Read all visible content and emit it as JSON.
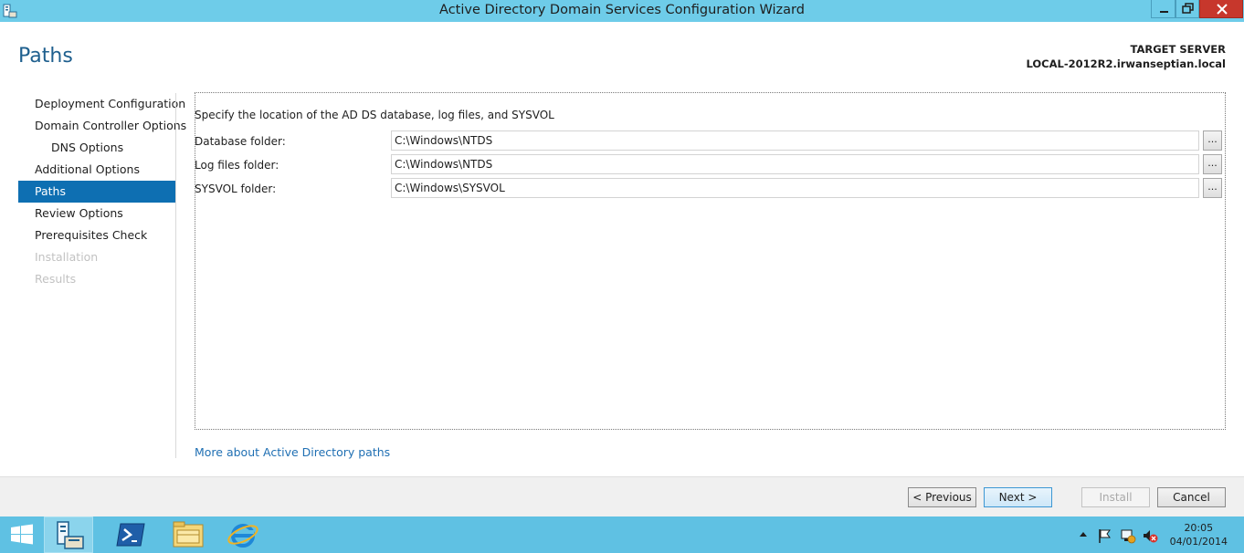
{
  "window": {
    "title": "Active Directory Domain Services Configuration Wizard"
  },
  "header": {
    "page_title": "Paths",
    "target_label": "TARGET SERVER",
    "target_name": "LOCAL-2012R2.irwanseptian.local"
  },
  "nav": {
    "items": [
      {
        "label": "Deployment Configuration",
        "state": "normal"
      },
      {
        "label": "Domain Controller Options",
        "state": "normal"
      },
      {
        "label": "DNS Options",
        "state": "sub"
      },
      {
        "label": "Additional Options",
        "state": "normal"
      },
      {
        "label": "Paths",
        "state": "active"
      },
      {
        "label": "Review Options",
        "state": "normal"
      },
      {
        "label": "Prerequisites Check",
        "state": "normal"
      },
      {
        "label": "Installation",
        "state": "disabled"
      },
      {
        "label": "Results",
        "state": "disabled"
      }
    ]
  },
  "content": {
    "instruction": "Specify the location of the AD DS database, log files, and SYSVOL",
    "fields": [
      {
        "label": "Database folder:",
        "value": "C:\\Windows\\NTDS"
      },
      {
        "label": "Log files folder:",
        "value": "C:\\Windows\\NTDS"
      },
      {
        "label": "SYSVOL folder:",
        "value": "C:\\Windows\\SYSVOL"
      }
    ],
    "browse_label": "...",
    "more_link": "More about Active Directory paths"
  },
  "footer": {
    "previous_label": "< Previous",
    "next_label": "Next >",
    "install_label": "Install",
    "cancel_label": "Cancel"
  },
  "taskbar": {
    "time": "20:05",
    "date": "04/01/2014"
  },
  "colors": {
    "titlebar": "#6ecce9",
    "accent": "#0e6fb2",
    "link": "#1f6fb3",
    "taskbar": "#5fc1e3",
    "close": "#c7372c"
  }
}
